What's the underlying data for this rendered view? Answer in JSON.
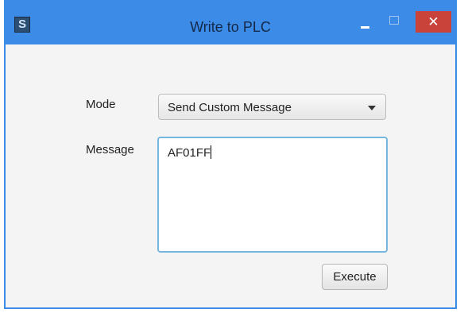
{
  "window": {
    "title": "Write to PLC",
    "app_icon_glyph": "S",
    "close_glyph": "✕",
    "accent_color": "#3c8be6",
    "close_color": "#c9433b"
  },
  "form": {
    "mode_label": "Mode",
    "mode_value": "Send Custom Message",
    "message_label": "Message",
    "message_value": "AF01FF",
    "execute_label": "Execute"
  },
  "icons": {
    "app": "app-logo-icon",
    "minimize": "minimize-icon",
    "maximize": "maximize-icon",
    "close": "close-icon",
    "dropdown": "chevron-down-icon"
  }
}
